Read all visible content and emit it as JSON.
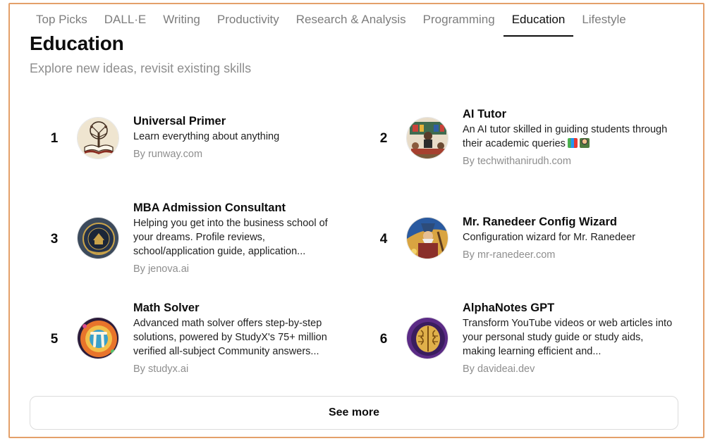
{
  "tabs": [
    {
      "label": "Top Picks",
      "active": false
    },
    {
      "label": "DALL·E",
      "active": false
    },
    {
      "label": "Writing",
      "active": false
    },
    {
      "label": "Productivity",
      "active": false
    },
    {
      "label": "Research & Analysis",
      "active": false
    },
    {
      "label": "Programming",
      "active": false
    },
    {
      "label": "Education",
      "active": true
    },
    {
      "label": "Lifestyle",
      "active": false
    }
  ],
  "section": {
    "title": "Education",
    "subtitle": "Explore new ideas, revisit existing skills"
  },
  "gpts": [
    {
      "rank": "1",
      "name": "Universal Primer",
      "description": "Learn everything about anything",
      "author": "By runway.com",
      "icon": "book-tree-icon"
    },
    {
      "rank": "2",
      "name": "AI Tutor",
      "description": "An AI tutor skilled in guiding students through their academic queries",
      "author": "By techwithanirudh.com",
      "icon": "classroom-icon"
    },
    {
      "rank": "3",
      "name": "MBA Admission Consultant",
      "description": "Helping you get into the business school of your dreams. Profile reviews, school/application guide, application...",
      "author": "By jenova.ai",
      "icon": "university-seal-icon"
    },
    {
      "rank": "4",
      "name": "Mr. Ranedeer Config Wizard",
      "description": "Configuration wizard for Mr. Ranedeer",
      "author": "By mr-ranedeer.com",
      "icon": "wizard-icon"
    },
    {
      "rank": "5",
      "name": "Math Solver",
      "description": "Advanced math solver offers step-by-step solutions, powered by StudyX's 75+ million verified all-subject Community answers...",
      "author": "By studyx.ai",
      "icon": "pi-icon"
    },
    {
      "rank": "6",
      "name": "AlphaNotes GPT",
      "description": "Transform YouTube videos or web articles into your personal study guide or study aids, making learning efficient and...",
      "author": "By davideai.dev",
      "icon": "brain-icon"
    }
  ],
  "see_more_label": "See more",
  "colors": {
    "frame_border": "#e4a06a",
    "muted_text": "#8e8e8e",
    "active_tab": "#0d0d0d"
  }
}
